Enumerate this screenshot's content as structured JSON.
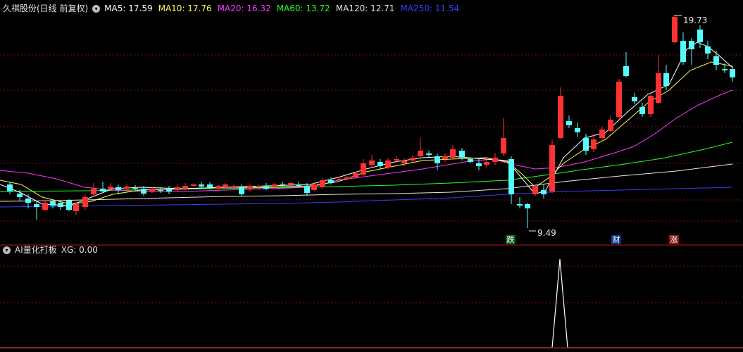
{
  "header": {
    "stock_title": "久祺股份(日线 前复权)",
    "ma_values": [
      {
        "label": "MA5: 17.59",
        "color": "#ffffff"
      },
      {
        "label": "MA10: 17.76",
        "color": "#ffff4a"
      },
      {
        "label": "MA20: 16.32",
        "color": "#ff36ff"
      },
      {
        "label": "MA60: 13.72",
        "color": "#25ff25"
      },
      {
        "label": "MA120: 12.71",
        "color": "#e6e6e6"
      },
      {
        "label": "MA250: 11.54",
        "color": "#3a3aff"
      }
    ]
  },
  "price_markers": {
    "high": "19.73",
    "low": "9.49"
  },
  "event_badges": [
    {
      "text": "跌",
      "bg": "#0b5d1e"
    },
    {
      "text": "财",
      "bg": "#0e2f8a"
    },
    {
      "text": "涨",
      "bg": "#8a1414"
    }
  ],
  "indicator": {
    "title": "AI量化打板",
    "xg_label": "XG: 0.00"
  },
  "colors": {
    "up": "#ff3232",
    "down": "#54ffff",
    "grid": "#7a1010",
    "separator": "#b01818"
  }
}
